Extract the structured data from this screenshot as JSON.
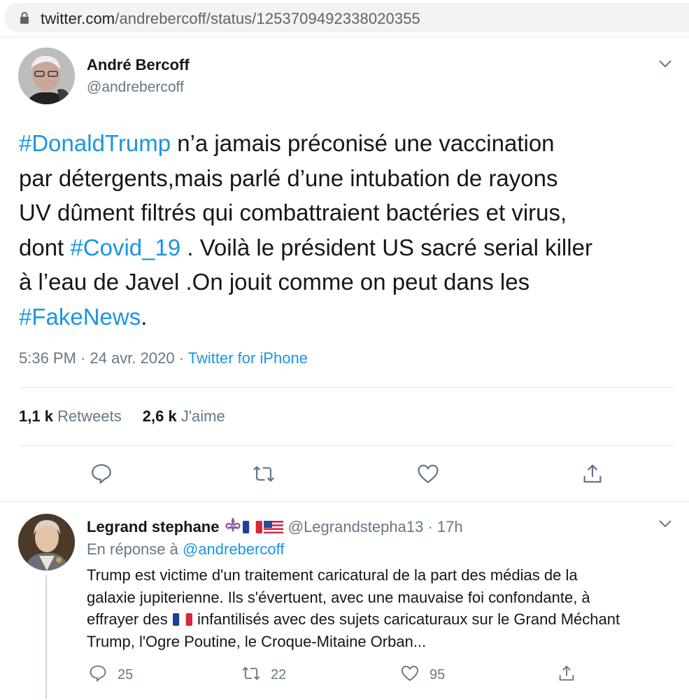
{
  "browser": {
    "url_domain": "twitter.com",
    "url_path": "/andrebercoff/status/1253709492338020355"
  },
  "tweet": {
    "author_name": "André Bercoff",
    "author_handle": "@andrebercoff",
    "text": {
      "l1_hashtag": "#DonaldTrump",
      "l1_rest": " n’a jamais préconisé une vaccination",
      "l2": "par détergents,mais parlé d’une intubation de rayons",
      "l3": "UV dûment filtrés qui combattraient  bactéries et virus,",
      "l4_pre": "dont ",
      "l4_hashtag": "#Covid_19",
      "l4_rest": " . Voilà le président US sacré serial killer",
      "l5": "à l’eau de Javel .On jouit  comme on peut dans les",
      "l6_hashtag": "#FakeNews",
      "l6_rest": "."
    },
    "time_date": "5:36 PM · 24 avr. 2020 · ",
    "source": "Twitter for iPhone",
    "retweets_count": "1,1 k",
    "retweets_label": "Retweets",
    "likes_count": "2,6 k",
    "likes_label": "J'aime"
  },
  "reply": {
    "author_name": "Legrand stephane",
    "author_handle": "@Legrandstepha13",
    "time": " · 17h",
    "in_reply_prefix": "En réponse à ",
    "in_reply_mention": "@andrebercoff",
    "text": {
      "l1": "Trump est victime d'un traitement caricatural de la part des médias de la",
      "l2": "galaxie jupiterienne. Ils s'évertuent, avec une mauvaise foi confondante, à",
      "l3_pre": "effrayer des ",
      "l3_post": " infantilisés avec des sujets caricaturaux sur le Grand Méchant",
      "l4": "Trump, l'Ogre Poutine, le Croque-Mitaine Orban..."
    },
    "replies_count": "25",
    "retweets_count": "22",
    "likes_count": "95"
  },
  "icons": {
    "lock": "lock-icon",
    "chevron": "chevron-down-icon",
    "reply": "reply-icon",
    "retweet": "retweet-icon",
    "like": "heart-icon",
    "share": "share-icon",
    "fleur": "fleur-de-lis-icon",
    "flag_fr": "flag-france-icon",
    "flag_us": "flag-usa-icon"
  },
  "colors": {
    "link": "#1b95e0",
    "muted": "#657786",
    "text": "#14171a"
  }
}
